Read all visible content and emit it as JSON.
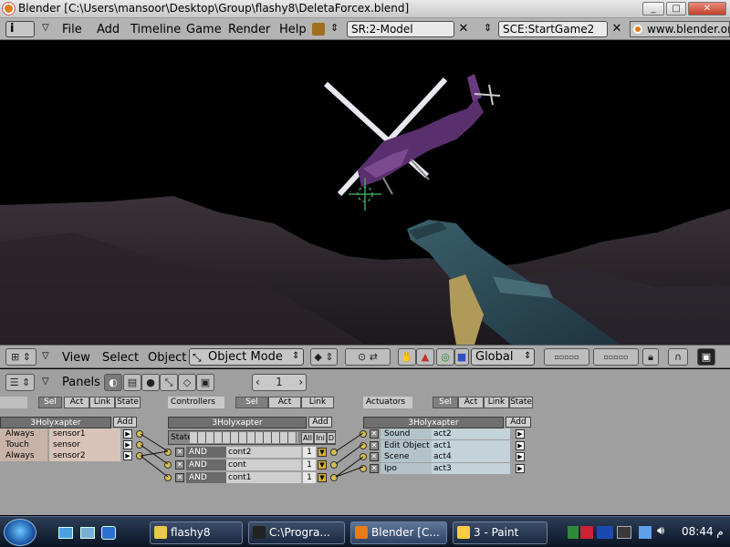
{
  "window": {
    "title": "Blender [C:\\Users\\mansoor\\Desktop\\Group\\flashy8\\DeletaForcex.blend]",
    "buttons": [
      "_",
      "□",
      "✕"
    ]
  },
  "menubar": {
    "info_icon": "i",
    "items": [
      "File",
      "Add",
      "Timeline",
      "Game",
      "Render",
      "Help"
    ],
    "screen_field": "SR:2-Model",
    "scene_field": "SCE:StartGame2",
    "url": "www.blender.or"
  },
  "view3d_header": {
    "menus": [
      "View",
      "Select",
      "Object"
    ],
    "mode": "Object Mode",
    "orientation": "Global"
  },
  "buttons_header": {
    "label": "Panels",
    "frame": "1"
  },
  "logic": {
    "sensors": {
      "title": "",
      "tabs": [
        "Sel",
        "Act",
        "Link",
        "State"
      ],
      "object": "3Holyxapter",
      "add": "Add",
      "items": [
        {
          "type": "Always",
          "name": "sensor1"
        },
        {
          "type": "Touch",
          "name": "sensor"
        },
        {
          "type": "Always",
          "name": "sensor2"
        }
      ]
    },
    "controllers": {
      "title": "Controllers",
      "tabs": [
        "Sel",
        "Act",
        "Link"
      ],
      "object": "3Holyxapter",
      "add": "Add",
      "state_label": "State",
      "state_buttons": [
        "All",
        "Ini",
        "D"
      ],
      "items": [
        {
          "type": "AND",
          "name": "cont2",
          "num": "1"
        },
        {
          "type": "AND",
          "name": "cont",
          "num": "1"
        },
        {
          "type": "AND",
          "name": "cont1",
          "num": "1"
        }
      ]
    },
    "actuators": {
      "title": "Actuators",
      "tabs": [
        "Sel",
        "Act",
        "Link",
        "State"
      ],
      "object": "3Holyxapter",
      "add": "Add",
      "items": [
        {
          "type": "Sound",
          "name": "act2"
        },
        {
          "type": "Edit Object",
          "name": "act1"
        },
        {
          "type": "Scene",
          "name": "act4"
        },
        {
          "type": "Ipo",
          "name": "act3"
        }
      ]
    }
  },
  "taskbar": {
    "tasks": [
      {
        "label": "flashy8",
        "icon_color": "#e8c84a"
      },
      {
        "label": "C:\\Progra...",
        "icon_color": "#222222"
      },
      {
        "label": "Blender [C...",
        "icon_color": "#e87a17"
      },
      {
        "label": "3 - Paint",
        "icon_color": "#ffcc44"
      }
    ],
    "clock": "08:44 م"
  },
  "colors": {
    "sensor": "#c9b3a8",
    "actuator": "#b3c3c9",
    "panel_bg": "#9f9f9f",
    "helicopter": "#5a2f6e"
  },
  "icons": [
    "blender-icon",
    "info-icon",
    "close-icon",
    "cursor-crosshair-icon",
    "grid-icon",
    "mode-icon",
    "hand-icon",
    "globe-icon",
    "start-orb-icon"
  ]
}
